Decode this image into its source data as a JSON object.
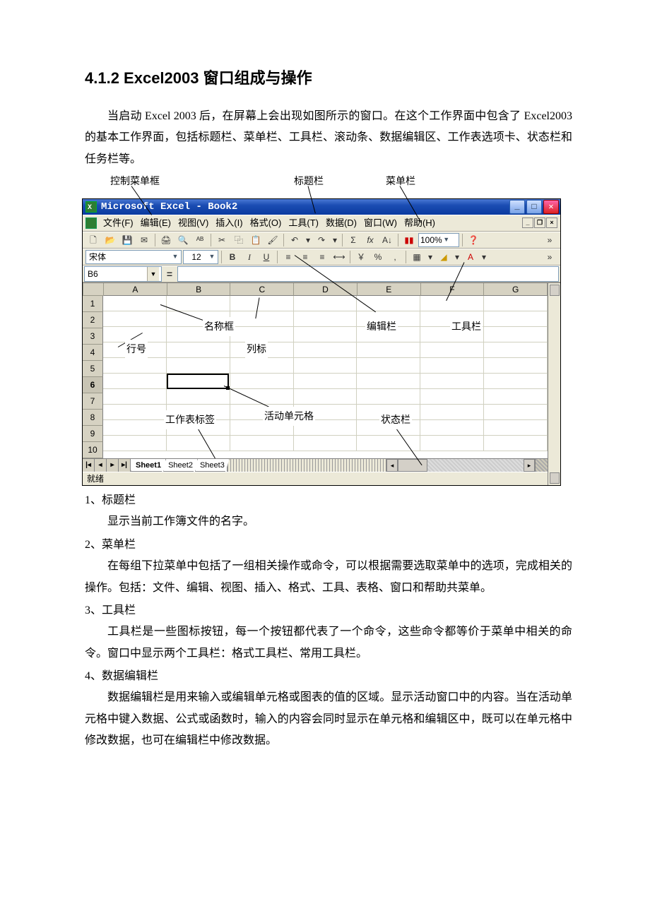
{
  "heading": "4.1.2 Excel2003 窗口组成与操作",
  "intro": "当启动 Excel 2003 后，在屏幕上会出现如图所示的窗口。在这个工作界面中包含了 Excel2003 的基本工作界面，包括标题栏、菜单栏、工具栏、滚动条、数据编辑区、工作表选项卡、状态栏和任务栏等。",
  "callouts": {
    "control_menu": "控制菜单框",
    "title_bar": "标题栏",
    "menu_bar": "菜单栏",
    "name_box": "名称框",
    "edit_bar": "编辑栏",
    "toolbar": "工具栏",
    "row_number": "行号",
    "column_label": "列标",
    "sheet_tab": "工作表标签",
    "active_cell": "活动单元格",
    "status_bar": "状态栏"
  },
  "excel": {
    "title": "Microsoft Excel - Book2",
    "menus": [
      "文件(F)",
      "编辑(E)",
      "视图(V)",
      "插入(I)",
      "格式(O)",
      "工具(T)",
      "数据(D)",
      "窗口(W)",
      "帮助(H)"
    ],
    "font_name": "宋体",
    "font_size": "12",
    "zoom": "100%",
    "cell_ref": "B6",
    "columns": [
      "A",
      "B",
      "C",
      "D",
      "E",
      "F",
      "G"
    ],
    "rows": [
      "1",
      "2",
      "3",
      "4",
      "5",
      "6",
      "7",
      "8",
      "9",
      "10"
    ],
    "sheet_tabs": [
      "Sheet1",
      "Sheet2",
      "Sheet3"
    ],
    "status": "就绪"
  },
  "defs": [
    {
      "title": "1、标题栏",
      "body": "显示当前工作簿文件的名字。"
    },
    {
      "title": "2、菜单栏",
      "body": "在每组下拉菜单中包括了一组相关操作或命令，可以根据需要选取菜单中的选项，完成相关的操作。包括：文件、编辑、视图、插入、格式、工具、表格、窗口和帮助共菜单。"
    },
    {
      "title": "3、工具栏",
      "body": "工具栏是一些图标按钮，每一个按钮都代表了一个命令，这些命令都等价于菜单中相关的命令。窗口中显示两个工具栏：格式工具栏、常用工具栏。"
    },
    {
      "title": "4、数据编辑栏",
      "body": "数据编辑栏是用来输入或编辑单元格或图表的值的区域。显示活动窗口中的内容。当在活动单元格中键入数据、公式或函数时，输入的内容会同时显示在单元格和编辑区中，既可以在单元格中修改数据，也可在编辑栏中修改数据。"
    }
  ]
}
